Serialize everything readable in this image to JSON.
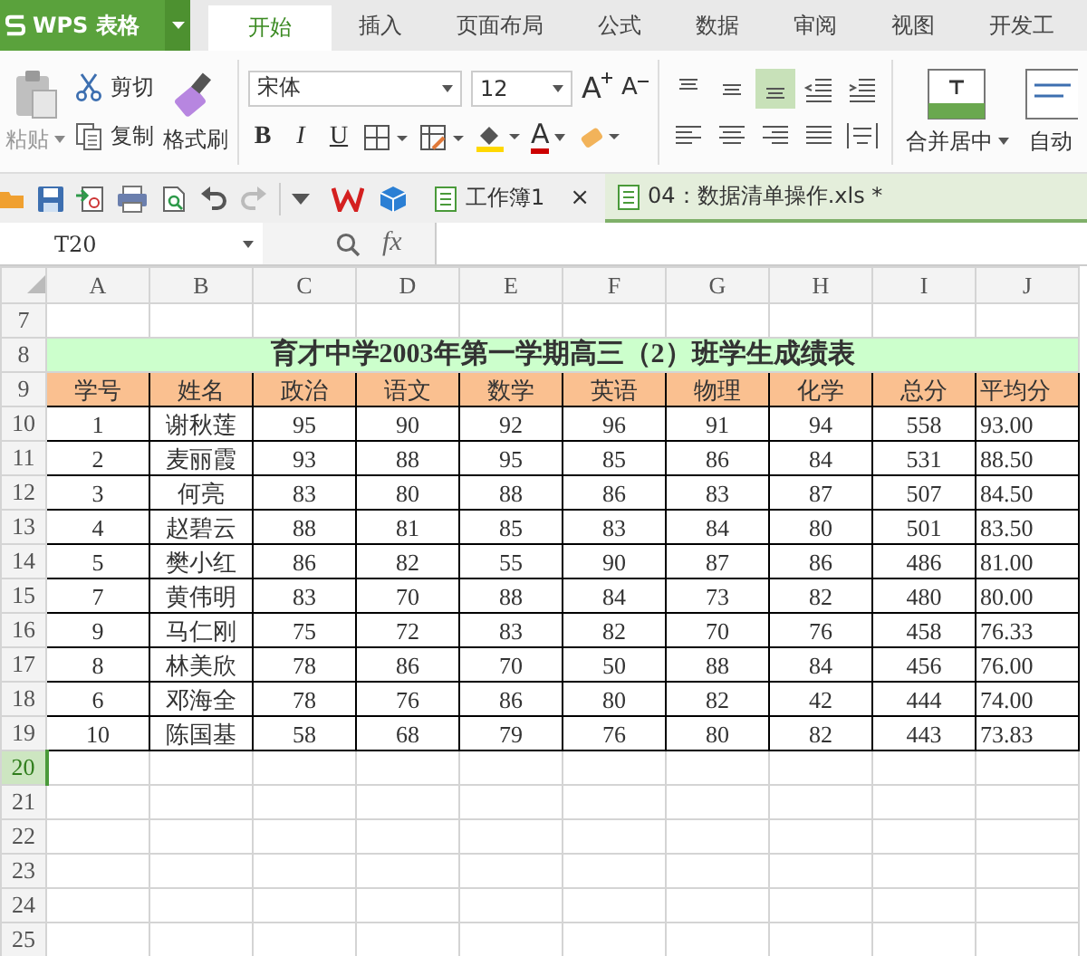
{
  "app": {
    "name": "WPS 表格"
  },
  "tabs": [
    {
      "label": "开始",
      "selected": true
    },
    {
      "label": "插入",
      "selected": false
    },
    {
      "label": "页面布局",
      "selected": false
    },
    {
      "label": "公式",
      "selected": false
    },
    {
      "label": "数据",
      "selected": false
    },
    {
      "label": "审阅",
      "selected": false
    },
    {
      "label": "视图",
      "selected": false
    },
    {
      "label": "开发工",
      "selected": false
    }
  ],
  "ribbon": {
    "paste": {
      "label": "粘贴",
      "disabled": true
    },
    "cut": "剪切",
    "copy": "复制",
    "format_painter": "格式刷",
    "font": {
      "value": "宋体"
    },
    "font_size": {
      "value": "12"
    },
    "bold": "B",
    "italic": "I",
    "underline": "U",
    "grow": "A",
    "shrink": "A",
    "font_color": "A",
    "vertical_align": [
      {
        "selected": false
      },
      {
        "selected": false
      },
      {
        "selected": true
      }
    ],
    "merge": "合并居中",
    "wrap": "自动"
  },
  "documents": [
    {
      "label": "工作簿1",
      "selected": false,
      "close": "×"
    },
    {
      "label": "04：数据清单操作.xls *",
      "selected": true
    }
  ],
  "formula_bar": {
    "name_box": "T20",
    "fx": "fx"
  },
  "sheet": {
    "columns": [
      "A",
      "B",
      "C",
      "D",
      "E",
      "F",
      "G",
      "H",
      "I",
      "J"
    ],
    "rows": [
      {
        "number": "7",
        "kind": "empty",
        "selected": false
      },
      {
        "number": "8",
        "kind": "title",
        "selected": false,
        "text": "育才中学2003年第一学期高三（2）班学生成绩表"
      },
      {
        "number": "9",
        "kind": "header",
        "selected": false,
        "cells": [
          "学号",
          "姓名",
          "政治",
          "语文",
          "数学",
          "英语",
          "物理",
          "化学",
          "总分",
          "平均分"
        ]
      },
      {
        "number": "10",
        "kind": "data",
        "selected": false,
        "cells": [
          "1",
          "谢秋莲",
          "95",
          "90",
          "92",
          "96",
          "91",
          "94",
          "558",
          "93.00"
        ]
      },
      {
        "number": "11",
        "kind": "data",
        "selected": false,
        "cells": [
          "2",
          "麦丽霞",
          "93",
          "88",
          "95",
          "85",
          "86",
          "84",
          "531",
          "88.50"
        ]
      },
      {
        "number": "12",
        "kind": "data",
        "selected": false,
        "cells": [
          "3",
          "何亮",
          "83",
          "80",
          "88",
          "86",
          "83",
          "87",
          "507",
          "84.50"
        ]
      },
      {
        "number": "13",
        "kind": "data",
        "selected": false,
        "cells": [
          "4",
          "赵碧云",
          "88",
          "81",
          "85",
          "83",
          "84",
          "80",
          "501",
          "83.50"
        ]
      },
      {
        "number": "14",
        "kind": "data",
        "selected": false,
        "cells": [
          "5",
          "樊小红",
          "86",
          "82",
          "55",
          "90",
          "87",
          "86",
          "486",
          "81.00"
        ]
      },
      {
        "number": "15",
        "kind": "data",
        "selected": false,
        "cells": [
          "7",
          "黄伟明",
          "83",
          "70",
          "88",
          "84",
          "73",
          "82",
          "480",
          "80.00"
        ]
      },
      {
        "number": "16",
        "kind": "data",
        "selected": false,
        "cells": [
          "9",
          "马仁刚",
          "75",
          "72",
          "83",
          "82",
          "70",
          "76",
          "458",
          "76.33"
        ]
      },
      {
        "number": "17",
        "kind": "data",
        "selected": false,
        "cells": [
          "8",
          "林美欣",
          "78",
          "86",
          "70",
          "50",
          "88",
          "84",
          "456",
          "76.00"
        ]
      },
      {
        "number": "18",
        "kind": "data",
        "selected": false,
        "cells": [
          "6",
          "邓海全",
          "78",
          "76",
          "86",
          "80",
          "82",
          "42",
          "444",
          "74.00"
        ]
      },
      {
        "number": "19",
        "kind": "data",
        "selected": false,
        "cells": [
          "10",
          "陈国基",
          "58",
          "68",
          "79",
          "76",
          "80",
          "82",
          "443",
          "73.83"
        ]
      },
      {
        "number": "20",
        "kind": "empty",
        "selected": true
      },
      {
        "number": "21",
        "kind": "empty",
        "selected": false
      },
      {
        "number": "22",
        "kind": "empty",
        "selected": false
      },
      {
        "number": "23",
        "kind": "empty",
        "selected": false
      },
      {
        "number": "24",
        "kind": "empty",
        "selected": false
      },
      {
        "number": "25",
        "kind": "empty",
        "selected": false
      }
    ]
  }
}
